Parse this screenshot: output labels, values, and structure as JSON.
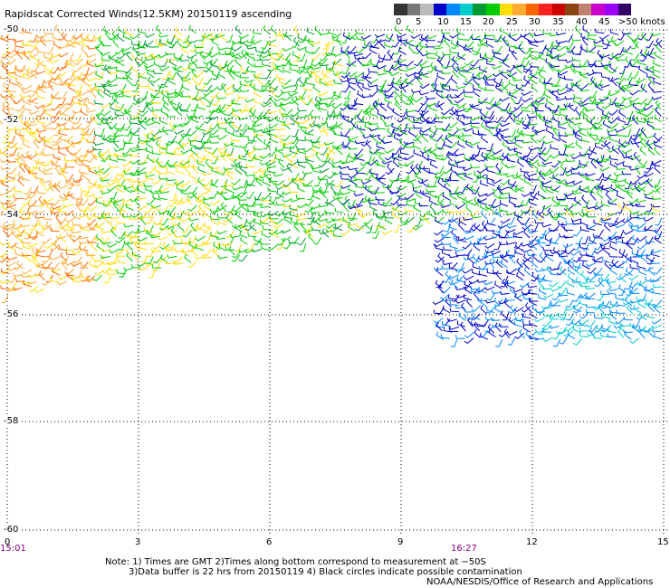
{
  "header": {
    "title": "Rapidscat Corrected Winds(12.5KM) 20150119 ascending"
  },
  "legend": {
    "colors": [
      "#333333",
      "#777777",
      "#bbbbbb",
      "#0000cc",
      "#0088ff",
      "#00cccc",
      "#009933",
      "#00cc00",
      "#ffdd00",
      "#ffaa33",
      "#ff6600",
      "#ff2222",
      "#cc0000",
      "#8b4513",
      "#c08070",
      "#cc00cc",
      "#9900ff",
      "#330066"
    ],
    "labels": [
      "0",
      "5",
      "10",
      "15",
      "20",
      "25",
      "30",
      "35",
      "40",
      "45"
    ],
    "units": ">50 knots"
  },
  "axes": {
    "y_labels": [
      "-50",
      "-52",
      "-54",
      "-56",
      "-58",
      "-60"
    ],
    "x_labels": [
      "0",
      "3",
      "6",
      "9",
      "12",
      "15"
    ],
    "time_labels": [
      "15:01",
      "16:27"
    ]
  },
  "footer": {
    "note_line1": "Note: 1) Times are GMT 2)Times along bottom correspond to measurement at −50S",
    "note_line2": "3)Data buffer is 22 hrs from 20150119 4) Black circles indicate possible contamination",
    "credit": "NOAA/NESDIS/Office of Research and Applications"
  }
}
